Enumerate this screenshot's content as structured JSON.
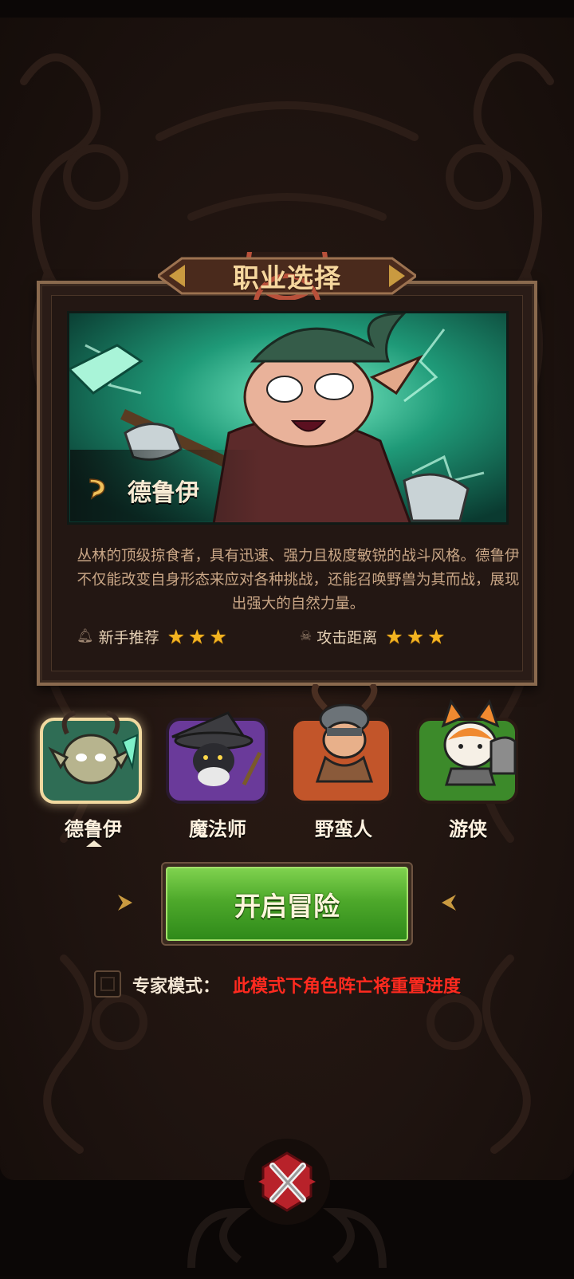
{
  "title": "职业选择",
  "hero": {
    "name": "德鲁伊",
    "description": "丛林的顶级掠食者，具有迅速、强力且极度敏锐的战斗风格。德鲁伊不仅能改变自身形态来应对各种挑战，还能召唤野兽为其而战，展现出强大的自然力量。",
    "stats": [
      {
        "label": "新手推荐",
        "stars": 3
      },
      {
        "label": "攻击距离",
        "stars": 3
      }
    ]
  },
  "characters": [
    {
      "name": "德鲁伊",
      "selected": true,
      "color": "#2f6d55"
    },
    {
      "name": "魔法师",
      "selected": false,
      "color": "#6a3a9a"
    },
    {
      "name": "野蛮人",
      "selected": false,
      "color": "#c2552a"
    },
    {
      "name": "游侠",
      "selected": false,
      "color": "#3c8a2a"
    }
  ],
  "start_button": "开启冒险",
  "expert_mode": {
    "label": "专家模式：",
    "warning": "此模式下角色阵亡将重置进度",
    "checked": false
  },
  "colors": {
    "accent": "#f2b320",
    "warning": "#ff2a1f",
    "start": "#4ea92b"
  }
}
